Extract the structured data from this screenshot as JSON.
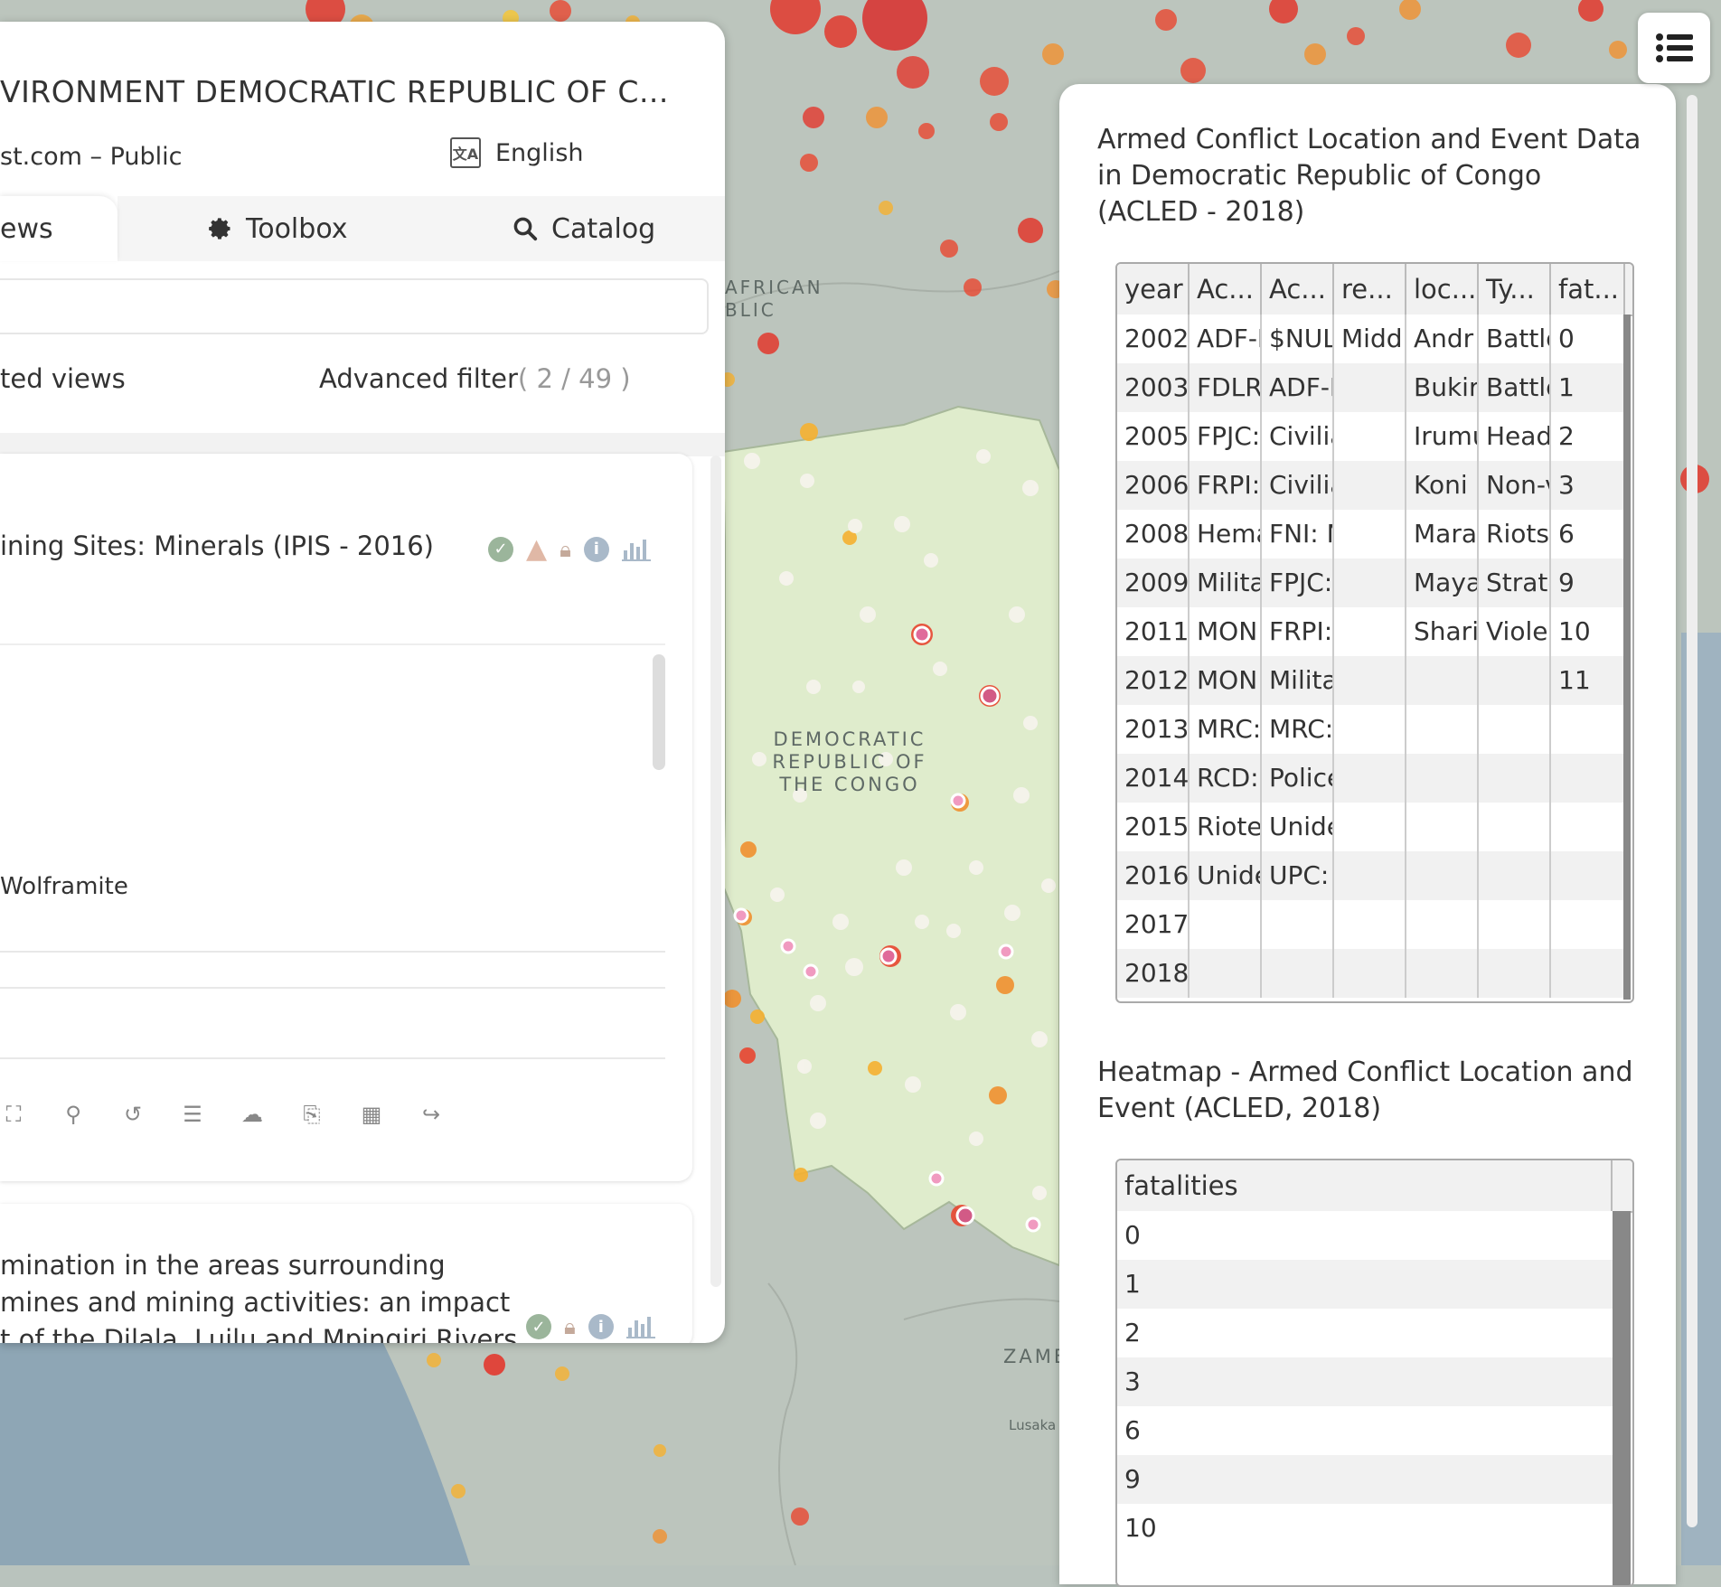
{
  "map": {
    "labels": {
      "car": [
        "AFRICAN",
        "BLIC"
      ],
      "drc": [
        "DEMOCRATIC",
        "REPUBLIC OF",
        "THE CONGO"
      ],
      "zambia": "ZAMB",
      "lusaka": "Lusaka"
    }
  },
  "left_panel": {
    "title": "VIRONMENT DEMOCRATIC REPUBLIC OF C...",
    "source": "st.com – Public",
    "language": "English",
    "tabs": {
      "views": "ews",
      "toolbox": "Toolbox",
      "catalog": "Catalog"
    },
    "selected_views": "ted views",
    "advanced_filter": "Advanced filter",
    "filter_count": "( 2 / 49 )",
    "card1": {
      "title": "ining Sites: Minerals (IPIS - 2016)",
      "legend_item": "Wolframite"
    },
    "card2": {
      "title_lines": [
        "mination in the areas surrounding",
        " mines and mining activities: an impact",
        "t of the Dilala, Luilu and Mpingiri Rivers,"
      ]
    }
  },
  "right_panel": {
    "section1_title": "Armed Conflict Location and Event Data in Democratic Republic of Congo (ACLED - 2018)",
    "table1": {
      "headers": [
        "year",
        "Ac...",
        "Ac...",
        "re...",
        "loc...",
        "Ty...",
        "fat..."
      ],
      "rows": [
        [
          "2002",
          "ADF-N",
          "$NUL",
          "Middl",
          "Andr",
          "Battle",
          "0"
        ],
        [
          "2003",
          "FDLR",
          "ADF-N",
          "",
          "Bukir",
          "Battle",
          "1"
        ],
        [
          "2005",
          "FPJC:",
          "Civilia",
          "",
          "Irumu",
          "Head",
          "2"
        ],
        [
          "2006",
          "FRPI:",
          "Civilia",
          "",
          "Koni",
          "Non-v",
          "3"
        ],
        [
          "2008",
          "Hema",
          "FNI: N",
          "",
          "Mara",
          "Riots/",
          "6"
        ],
        [
          "2009",
          "Milita",
          "FPJC:",
          "",
          "Maya",
          "Strate",
          "9"
        ],
        [
          "2011",
          "MON",
          "FRPI:",
          "",
          "Shari",
          "Violer",
          "10"
        ],
        [
          "2012",
          "MON",
          "Milita",
          "",
          "",
          "",
          "11"
        ],
        [
          "2013",
          "MRC:",
          "MRC:",
          "",
          "",
          "",
          ""
        ],
        [
          "2014",
          "RCD:",
          "Police",
          "",
          "",
          "",
          ""
        ],
        [
          "2015",
          "Riote",
          "Unide",
          "",
          "",
          "",
          ""
        ],
        [
          "2016",
          "Unide",
          "UPC:",
          "",
          "",
          "",
          ""
        ],
        [
          "2017",
          "",
          "",
          "",
          "",
          "",
          ""
        ],
        [
          "2018",
          "",
          "",
          "",
          "",
          "",
          ""
        ]
      ]
    },
    "section2_title": "Heatmap - Armed Conflict Location and Event (ACLED, 2018)",
    "table2": {
      "header": "fatalities",
      "rows": [
        "0",
        "1",
        "2",
        "3",
        "6",
        "9",
        "10"
      ]
    }
  }
}
